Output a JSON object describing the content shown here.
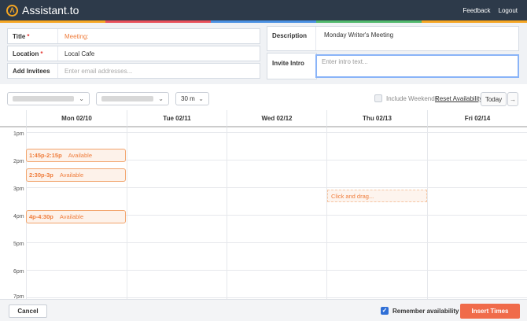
{
  "header": {
    "logo_glyph": "Λ",
    "app_name": "Assistant.to",
    "links": [
      "Feedback",
      "Logout"
    ],
    "accent_colors": [
      "#f5a623",
      "#e8505b",
      "#4a90e2",
      "#50b86c",
      "#f5a623"
    ]
  },
  "form": {
    "title_label": "Title",
    "title_value": "Meeting:",
    "location_label": "Location",
    "location_value": "Local Cafe",
    "invitees_label": "Add Invitees",
    "invitees_placeholder": "Enter email addresses...",
    "description_label": "Description",
    "description_value": "Monday Writer's Meeting",
    "intro_label": "Invite Intro",
    "intro_placeholder": "Enter intro text...",
    "required_mark": "*"
  },
  "toolbar": {
    "duration": "30 m",
    "include_weekends": "Include Weekends",
    "reset_availability": "Reset Availability",
    "today": "Today",
    "next_glyph": "→"
  },
  "calendar": {
    "days": [
      "Mon 02/10",
      "Tue 02/11",
      "Wed 02/12",
      "Thu 02/13",
      "Fri 02/14"
    ],
    "times": [
      "1pm",
      "2pm",
      "3pm",
      "4pm",
      "5pm",
      "6pm",
      "7pm"
    ],
    "slots": [
      {
        "time": "1:45p-2:15p",
        "status": "Available"
      },
      {
        "time": "2:30p-3p",
        "status": "Available"
      },
      {
        "time": "4p-4:30p",
        "status": "Available"
      }
    ],
    "drag_hint": "Click and drag..."
  },
  "footer": {
    "cancel": "Cancel",
    "remember": "Remember availability",
    "insert": "Insert Times"
  }
}
